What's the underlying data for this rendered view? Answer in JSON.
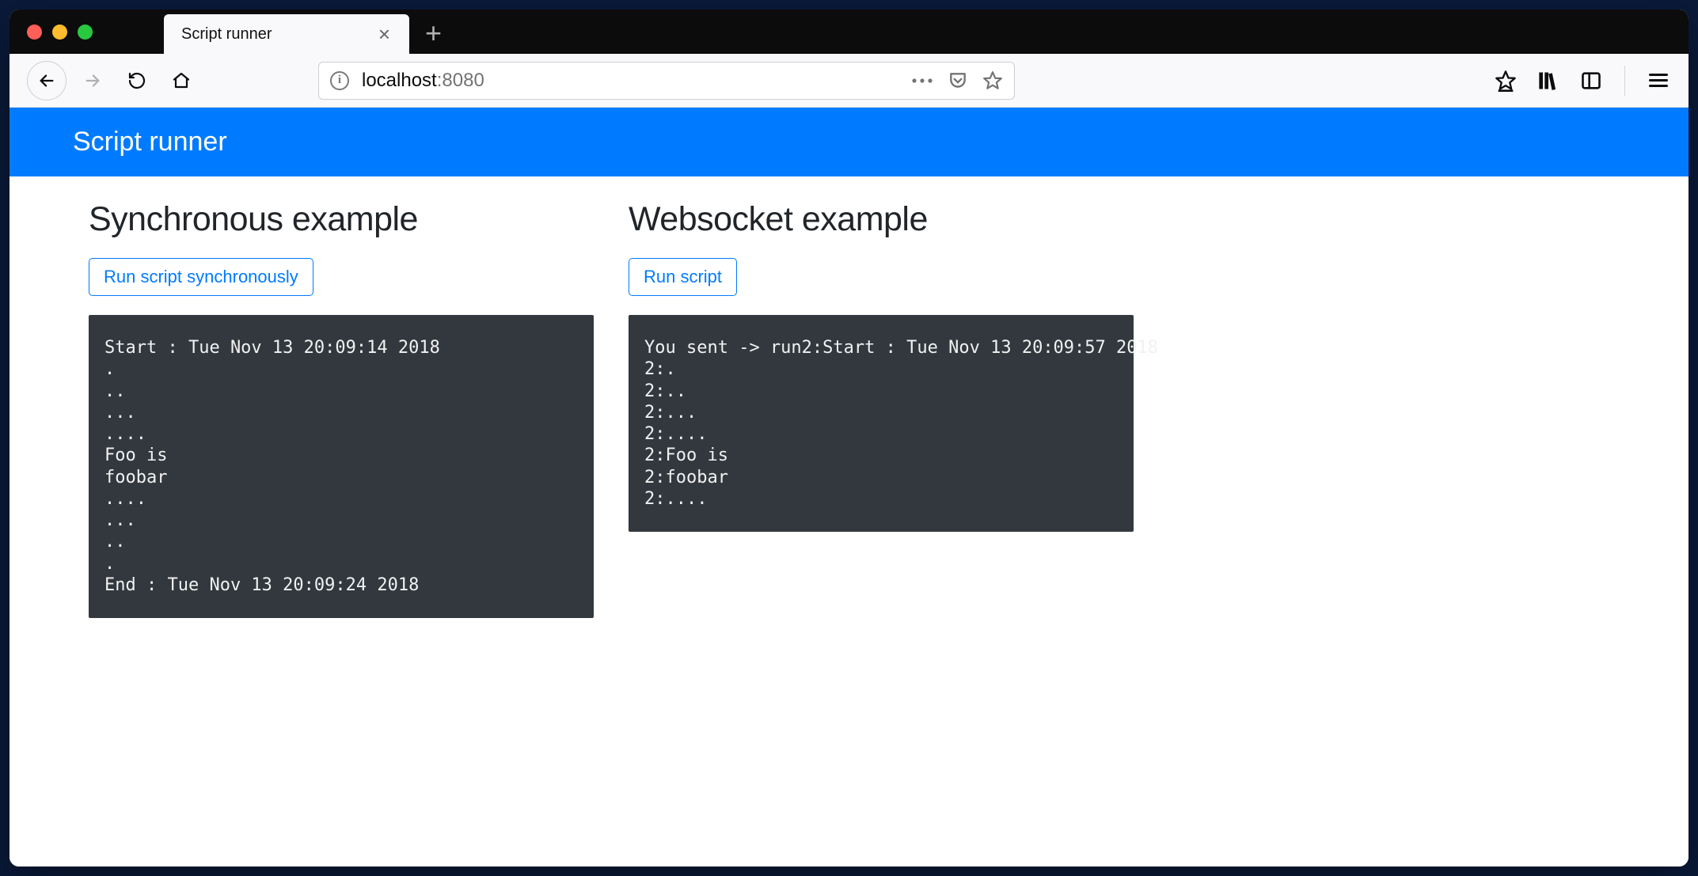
{
  "browser": {
    "tab_title": "Script runner",
    "url_host": "localhost",
    "url_port": ":8080"
  },
  "app": {
    "header_title": "Script runner"
  },
  "sync": {
    "heading": "Synchronous example",
    "button": "Run script synchronously",
    "output": "Start : Tue Nov 13 20:09:14 2018\n.\n..\n...\n....\nFoo is\nfoobar\n....\n...\n..\n.\nEnd : Tue Nov 13 20:09:24 2018"
  },
  "ws": {
    "heading": "Websocket example",
    "button": "Run script",
    "output": "You sent -> run2:Start : Tue Nov 13 20:09:57 2018\n2:.\n2:..\n2:...\n2:....\n2:Foo is\n2:foobar\n2:...."
  }
}
